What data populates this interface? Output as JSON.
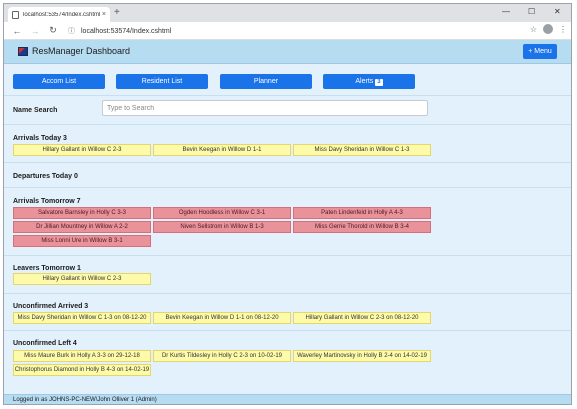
{
  "browser": {
    "tab_title": "localhost:53574/Index.cshtml",
    "tab_close": "×",
    "new_tab": "+",
    "minimize": "—",
    "maximize": "☐",
    "close": "✕",
    "back": "←",
    "forward": "→",
    "reload": "↻",
    "url": "localhost:53574/Index.cshtml",
    "info_icon": "ⓘ",
    "toolbar_icons": [
      "☆",
      "⋮"
    ]
  },
  "app": {
    "title": "ResManager Dashboard",
    "menu_label": "+ Menu",
    "nav": {
      "accom": "Accom List",
      "resident": "Resident List",
      "planner": "Planner",
      "alerts": "Alerts",
      "alerts_count": "3"
    },
    "search": {
      "label": "Name Search",
      "placeholder": "Type to Search",
      "value": ""
    },
    "sections": {
      "arrivals_today": {
        "title": "Arrivals Today 3",
        "items": [
          "Hillary Gallant in Willow C 2-3",
          "Bevin Keegan in Willow D 1-1",
          "Miss Davy Sheridan in Willow C 1-3"
        ]
      },
      "departures_today": {
        "title": "Departures Today 0",
        "items": []
      },
      "arrivals_tomorrow": {
        "title": "Arrivals Tomorrow 7",
        "items": [
          "Salvatore Barnsley in Holly C 3-3",
          "Ogden Hoodless in Willow C 3-1",
          "Paten Lindenfeld in Holly A 4-3",
          "Dr Jillian Mountney in Willow A 2-2",
          "Niven Sellstrom in Willow B 1-3",
          "Miss Gerrie Thorold in Willow B 3-4",
          "Miss Lonni Ure in Willow B 3-1"
        ]
      },
      "leavers_tomorrow": {
        "title": "Leavers Tomorrow 1",
        "items": [
          "Hillary Gallant in Willow C 2-3"
        ]
      },
      "unconfirmed_arrived": {
        "title": "Unconfirmed Arrived 3",
        "items": [
          "Miss Davy Sheridan in Willow C 1-3 on 08-12-20",
          "Bevin Keegan in Willow D 1-1 on 08-12-20",
          "Hillary Gallant in Willow C 2-3 on 08-12-20"
        ]
      },
      "unconfirmed_left": {
        "title": "Unconfirmed Left 4",
        "items": [
          "Miss Maure Burk in Holly A 3-3 on 29-12-18",
          "Dr Kurtis Tildesley in Holly C 2-3 on 10-02-19",
          "Waverley Martinovsky in Holly B 2-4 on 14-02-19",
          "Christophorus Diamond in Holly B 4-3 on 14-02-19"
        ]
      }
    },
    "footer": "Logged in as JOHNS-PC-NEW\\John Olliver 1 (Admin)"
  },
  "colors": {
    "accent": "#1a73e8",
    "appbar": "#b6dcf2",
    "background": "#e2f1fb",
    "yellow_cell": "#fdfaa9",
    "red_cell": "#e9929a"
  }
}
